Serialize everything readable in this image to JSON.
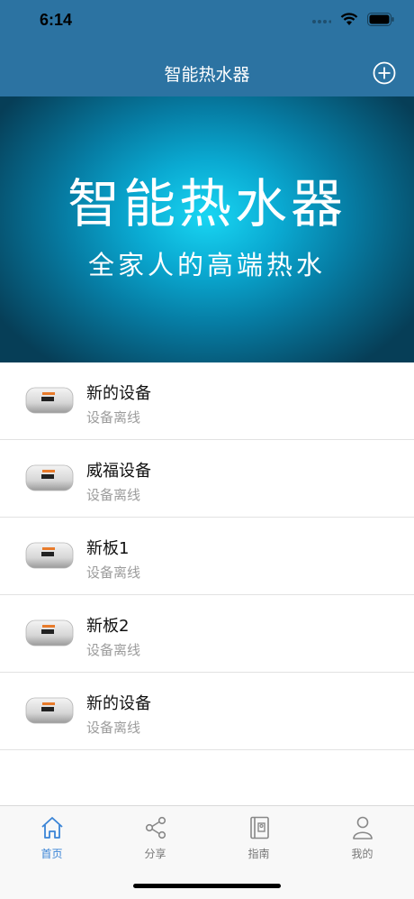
{
  "status_bar": {
    "time": "6:14"
  },
  "nav": {
    "title": "智能热水器",
    "add_icon": "plus-circle-icon"
  },
  "hero": {
    "title": "智能热水器",
    "subtitle": "全家人的高端热水"
  },
  "devices": [
    {
      "name": "新的设备",
      "status": "设备离线"
    },
    {
      "name": "威福设备",
      "status": "设备离线"
    },
    {
      "name": "新板1",
      "status": "设备离线"
    },
    {
      "name": "新板2",
      "status": "设备离线"
    },
    {
      "name": "新的设备",
      "status": "设备离线"
    }
  ],
  "tabs": [
    {
      "label": "首页",
      "icon": "home-icon",
      "active": true
    },
    {
      "label": "分享",
      "icon": "share-icon",
      "active": false
    },
    {
      "label": "指南",
      "icon": "guide-icon",
      "active": false
    },
    {
      "label": "我的",
      "icon": "user-icon",
      "active": false
    }
  ],
  "colors": {
    "nav": "#2c73a2",
    "tab_active": "#3a84d6",
    "status_gray": "#9c9c9c"
  }
}
